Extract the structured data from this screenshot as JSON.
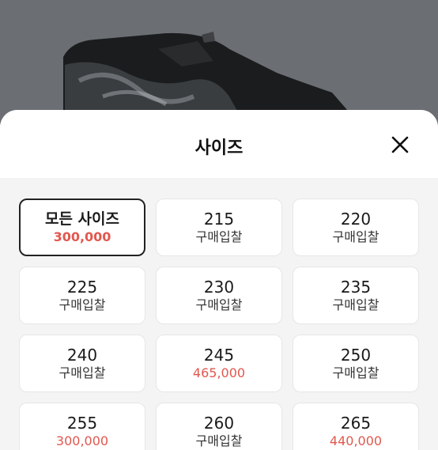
{
  "sheet": {
    "title": "사이즈",
    "close_icon": "close-icon"
  },
  "sizes": [
    {
      "label": "모든 사이즈",
      "sub": "300,000",
      "type": "price",
      "selected": true
    },
    {
      "label": "215",
      "sub": "구매입찰",
      "type": "bid"
    },
    {
      "label": "220",
      "sub": "구매입찰",
      "type": "bid"
    },
    {
      "label": "225",
      "sub": "구매입찰",
      "type": "bid"
    },
    {
      "label": "230",
      "sub": "구매입찰",
      "type": "bid"
    },
    {
      "label": "235",
      "sub": "구매입찰",
      "type": "bid"
    },
    {
      "label": "240",
      "sub": "구매입찰",
      "type": "bid"
    },
    {
      "label": "245",
      "sub": "465,000",
      "type": "price"
    },
    {
      "label": "250",
      "sub": "구매입찰",
      "type": "bid"
    },
    {
      "label": "255",
      "sub": "300,000",
      "type": "price"
    },
    {
      "label": "260",
      "sub": "구매입찰",
      "type": "bid"
    },
    {
      "label": "265",
      "sub": "440,000",
      "type": "price"
    }
  ],
  "colors": {
    "price": "#e1584f",
    "selected_border": "#222222",
    "backdrop": "#6b6f74"
  }
}
